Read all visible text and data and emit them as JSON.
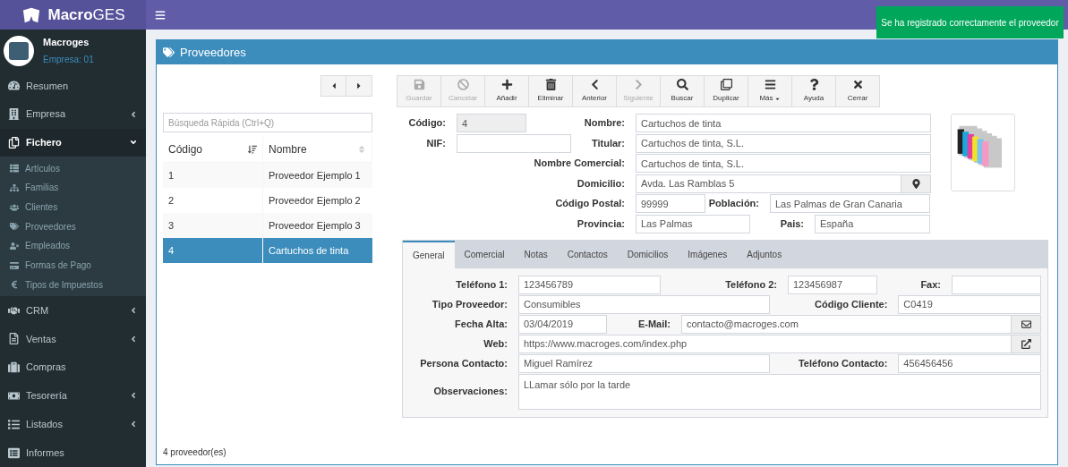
{
  "brand": {
    "name_bold": "Macro",
    "name_rest": "GES"
  },
  "user": {
    "name": "Macroges",
    "company": "Empresa: 01"
  },
  "toast": {
    "text": "Se ha registrado correctamente el proveedor"
  },
  "sidebar": {
    "items": [
      {
        "label": "Resumen",
        "kind": "link",
        "selected": false
      },
      {
        "label": "Empresa",
        "kind": "group",
        "selected": false,
        "expanded": false
      },
      {
        "label": "Fichero",
        "kind": "group",
        "selected": true,
        "expanded": true,
        "children": [
          {
            "label": "Artículos"
          },
          {
            "label": "Familias"
          },
          {
            "label": "Clientes"
          },
          {
            "label": "Proveedores"
          },
          {
            "label": "Empleados"
          },
          {
            "label": "Formas de Pago"
          },
          {
            "label": "Tipos de Impuestos"
          }
        ]
      },
      {
        "label": "CRM",
        "kind": "group",
        "selected": false,
        "expanded": false
      },
      {
        "label": "Ventas",
        "kind": "group",
        "selected": false,
        "expanded": false
      },
      {
        "label": "Compras",
        "kind": "link",
        "selected": false
      },
      {
        "label": "Tesorería",
        "kind": "group",
        "selected": false,
        "expanded": false
      },
      {
        "label": "Listados",
        "kind": "group",
        "selected": false,
        "expanded": false
      },
      {
        "label": "Informes",
        "kind": "link",
        "selected": false
      }
    ]
  },
  "panel": {
    "title": "Proveedores"
  },
  "search": {
    "placeholder": "Búsqueda Rápida (Ctrl+Q)"
  },
  "table": {
    "columns": [
      {
        "label": "Código",
        "sorted": true
      },
      {
        "label": "Nombre",
        "sorted": false
      }
    ],
    "rows": [
      {
        "cells": [
          "1",
          "Proveedor Ejemplo 1"
        ],
        "selected": false
      },
      {
        "cells": [
          "2",
          "Proveedor Ejemplo 2"
        ],
        "selected": false
      },
      {
        "cells": [
          "3",
          "Proveedor Ejemplo 3"
        ],
        "selected": false
      },
      {
        "cells": [
          "4",
          "Cartuchos de tinta"
        ],
        "selected": true
      }
    ]
  },
  "footer": {
    "count": "4 proveedor(es)"
  },
  "toolbar": [
    {
      "label": "Guardar",
      "disabled": true
    },
    {
      "label": "Cancelar",
      "disabled": true
    },
    {
      "label": "Añadir",
      "disabled": false
    },
    {
      "label": "Eliminar",
      "disabled": false
    },
    {
      "label": "Anterior",
      "disabled": false
    },
    {
      "label": "Siguiente",
      "disabled": true
    },
    {
      "label": "Buscar",
      "disabled": false
    },
    {
      "label": "Duplicar",
      "disabled": false
    },
    {
      "label": "Más",
      "disabled": false,
      "kind": "dropdown"
    },
    {
      "label": "Ayuda",
      "disabled": false
    },
    {
      "label": "Cerrar",
      "disabled": false
    }
  ],
  "form_rows": [
    [
      {
        "label": "Código:",
        "value": "4",
        "readonly": true
      },
      {
        "label": "Nombre:",
        "value": "Cartuchos de tinta"
      }
    ],
    [
      {
        "label": "NIF:"
      },
      {
        "label": "Titular:",
        "value": "Cartuchos de tinta, S.L."
      }
    ],
    [
      {
        "label": "Nombre Comercial:",
        "value": "Cartuchos de tinta, S.L."
      }
    ],
    [
      {
        "label": "Domicilio:",
        "value": "Avda. Las Ramblas 5",
        "kind": "address"
      }
    ],
    [
      {
        "label": "Código Postal:",
        "value": "99999"
      },
      {
        "label": "Población:",
        "value": "Las Palmas de Gran Canaria"
      }
    ],
    [
      {
        "label": "Provincia:",
        "value": "Las Palmas"
      },
      {
        "label": "Pais:",
        "value": "España"
      }
    ]
  ],
  "product_image": {
    "kind": "picture"
  },
  "tabs": [
    {
      "label": "General",
      "selected": true
    },
    {
      "label": "Comercial",
      "selected": false
    },
    {
      "label": "Notas",
      "selected": false
    },
    {
      "label": "Contactos",
      "selected": false
    },
    {
      "label": "Domicilios",
      "selected": false
    },
    {
      "label": "Imágenes",
      "selected": false
    },
    {
      "label": "Adjuntos",
      "selected": false
    }
  ],
  "tab_rows": [
    [
      {
        "label": "Teléfono 1:",
        "value": "123456789"
      },
      {
        "label": "Teléfono 2:",
        "value": "123456987"
      },
      {
        "label": "Fax:"
      }
    ],
    [
      {
        "label": "Tipo Proveedor:",
        "value": "Consumibles"
      },
      {
        "label": "Código Cliente:",
        "value": "C0419"
      }
    ],
    [
      {
        "label": "Fecha Alta:",
        "value": "03/04/2019"
      },
      {
        "label": "E-Mail:",
        "value": "contacto@macroges.com",
        "kind": "email"
      }
    ],
    [
      {
        "label": "Web:",
        "value": "https://www.macroges.com/index.php",
        "kind": "link"
      }
    ],
    [
      {
        "label": "Persona Contacto:",
        "value": "Miguel Ramírez"
      },
      {
        "label": "Teléfono Contacto:",
        "value": "456456456"
      }
    ],
    [
      {
        "label": "Observaciones:",
        "value": "LLamar sólo por la tarde",
        "kind": "textarea"
      }
    ]
  ]
}
